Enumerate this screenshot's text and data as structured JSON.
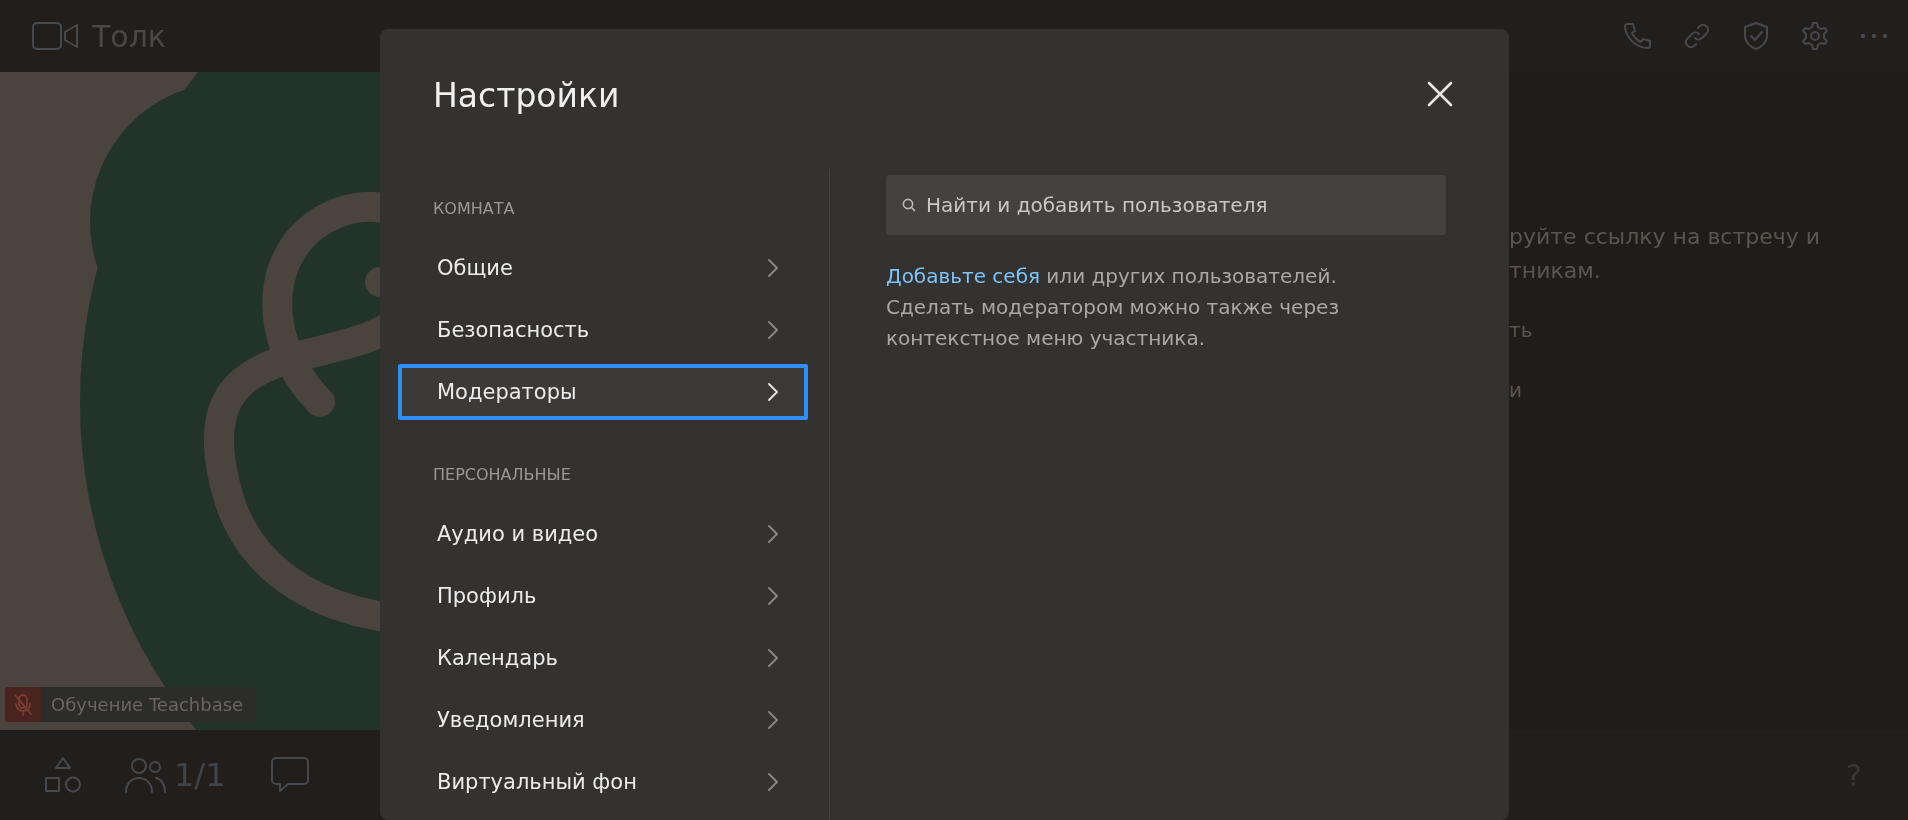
{
  "app": {
    "name": "Толк"
  },
  "video": {
    "participant": "Обучение Teachbase",
    "muted": true
  },
  "bottom_bar": {
    "participants_count": "1/1",
    "help": "?"
  },
  "side_panel": {
    "lines": [
      "руйте ссылку на встречу и",
      "тникам."
    ],
    "items": [
      "ть",
      "и"
    ]
  },
  "settings": {
    "title": "Настройки",
    "sections": [
      {
        "heading": "КОМНАТА",
        "items": [
          {
            "label": "Общие",
            "selected": false
          },
          {
            "label": "Безопасность",
            "selected": false
          },
          {
            "label": "Модераторы",
            "selected": true
          }
        ]
      },
      {
        "heading": "ПЕРСОНАЛЬНЫЕ",
        "items": [
          {
            "label": "Аудио и видео",
            "selected": false
          },
          {
            "label": "Профиль",
            "selected": false
          },
          {
            "label": "Календарь",
            "selected": false
          },
          {
            "label": "Уведомления",
            "selected": false
          },
          {
            "label": "Виртуальный фон",
            "selected": false
          }
        ]
      }
    ],
    "search": {
      "placeholder": "Найти и добавить пользователя"
    },
    "hint": {
      "link": "Добавьте себя",
      "text": " или других пользователей. Сделать модератором можно также через контекстное меню участника."
    }
  }
}
